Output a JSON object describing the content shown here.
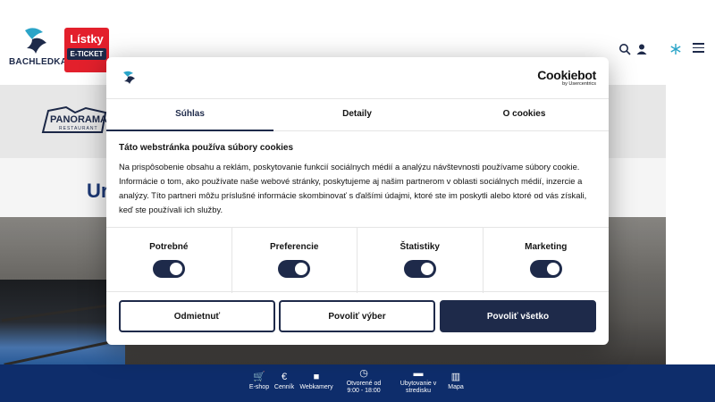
{
  "header": {
    "brand_name": "BACHLEDKA",
    "tickets_badge": {
      "title": "Lístky",
      "subtitle": "E-TICKET"
    },
    "icons": [
      "search-icon",
      "user-icon",
      "snowflake-icon",
      "menu-icon"
    ]
  },
  "venue_logo": {
    "name": "PANORAMA",
    "subtitle": "RESTAURANT"
  },
  "page": {
    "heading_fragment": "Ur"
  },
  "bottom_nav": [
    {
      "icon": "cart-icon",
      "glyph": "🛒",
      "label": "E-shop"
    },
    {
      "icon": "euro-icon",
      "glyph": "€",
      "label": "Cenník"
    },
    {
      "icon": "camera-icon",
      "glyph": "■",
      "label": "Webkamery"
    },
    {
      "icon": "clock-icon",
      "glyph": "◷",
      "label_line1": "Otvorené od",
      "label_line2": "9:00 - 18:00"
    },
    {
      "icon": "bed-icon",
      "glyph": "▬",
      "label_line1": "Ubytovanie v",
      "label_line2": "stredisku"
    },
    {
      "icon": "map-icon",
      "glyph": "▥",
      "label": "Mapa"
    }
  ],
  "cookie_dialog": {
    "provider": {
      "name": "Cookiebot",
      "by": "by Usercentrics"
    },
    "tabs": [
      {
        "label": "Súhlas",
        "active": true
      },
      {
        "label": "Detaily",
        "active": false
      },
      {
        "label": "O cookies",
        "active": false
      }
    ],
    "heading": "Táto webstránka používa súbory cookies",
    "body": "Na prispôsobenie obsahu a reklám, poskytovanie funkcií sociálnych médií a analýzu návštevnosti používame súbory cookie. Informácie o tom, ako používate naše webové stránky, poskytujeme aj našim partnerom v oblasti sociálnych médií, inzercie a analýzy. Títo partneri môžu príslušné informácie skombinovať s ďalšími údajmi, ktoré ste im poskytli alebo ktoré od vás získali, keď ste používali ich služby.",
    "categories": [
      {
        "label": "Potrebné",
        "enabled": true
      },
      {
        "label": "Preferencie",
        "enabled": true
      },
      {
        "label": "Štatistiky",
        "enabled": true
      },
      {
        "label": "Marketing",
        "enabled": true
      }
    ],
    "buttons": {
      "deny": "Odmietnuť",
      "allow_selection": "Povoliť výber",
      "allow_all": "Povoliť všetko"
    }
  },
  "colors": {
    "navy": "#1e2a4a",
    "brand_blue": "#0e2d6b",
    "ticket_red": "#e3202c"
  }
}
